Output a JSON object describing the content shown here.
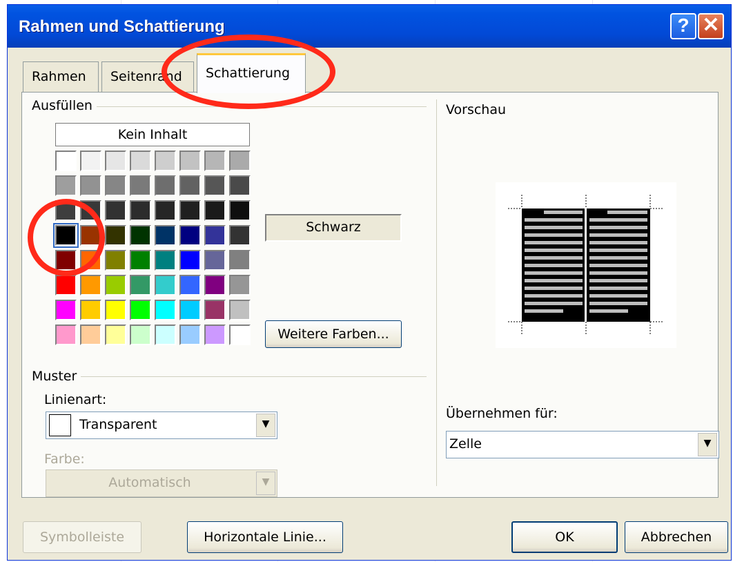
{
  "window": {
    "title": "Rahmen und Schattierung",
    "help_glyph": "?",
    "close_glyph": "✕"
  },
  "tabs": [
    {
      "label": "Rahmen",
      "active": false
    },
    {
      "label": "Seitenrand",
      "active": false
    },
    {
      "label": "Schattierung",
      "active": true
    }
  ],
  "fill": {
    "group_label": "Ausfüllen",
    "no_fill_label": "Kein Inhalt",
    "selected_color_name": "Schwarz",
    "more_colors_label": "Weitere Farben...",
    "selected_index": 24,
    "palette": [
      "#ffffff",
      "#f2f2f2",
      "#e6e6e6",
      "#dadada",
      "#cecece",
      "#c2c2c2",
      "#b6b6b6",
      "#aaaaaa",
      "#9e9e9e",
      "#929292",
      "#868686",
      "#7a7a7a",
      "#6e6e6e",
      "#626262",
      "#565656",
      "#4a4a4a",
      "#3e3e3e",
      "#383838",
      "#323232",
      "#2c2c2c",
      "#262626",
      "#202020",
      "#1a1a1a",
      "#0e0e0e",
      "#000000",
      "#993300",
      "#333300",
      "#003300",
      "#003366",
      "#000080",
      "#333399",
      "#333333",
      "#800000",
      "#ff6600",
      "#808000",
      "#008000",
      "#008080",
      "#0000ff",
      "#666699",
      "#808080",
      "#ff0000",
      "#ff9900",
      "#99cc00",
      "#339966",
      "#33cccc",
      "#3366ff",
      "#800080",
      "#969696",
      "#ff00ff",
      "#ffcc00",
      "#ffff00",
      "#00ff00",
      "#00ffff",
      "#00ccff",
      "#993366",
      "#c0c0c0",
      "#ff99cc",
      "#ffcc99",
      "#ffff99",
      "#ccffcc",
      "#ccffff",
      "#99ccff",
      "#cc99ff",
      "#ffffff"
    ]
  },
  "pattern": {
    "group_label": "Muster",
    "style_label": "Linienart:",
    "style_value": "Transparent",
    "color_label": "Farbe:",
    "color_value": "Automatisch"
  },
  "preview": {
    "group_label": "Vorschau",
    "apply_label": "Übernehmen für:",
    "apply_value": "Zelle"
  },
  "footer": {
    "toolbar_label": "Symbolleiste",
    "horizontal_line_label": "Horizontale Linie...",
    "ok_label": "OK",
    "cancel_label": "Abbrechen"
  },
  "colors": {
    "titlebar": "#0153e0",
    "dialog_bg": "#ece9d8",
    "annotation": "#ff2a1a"
  }
}
